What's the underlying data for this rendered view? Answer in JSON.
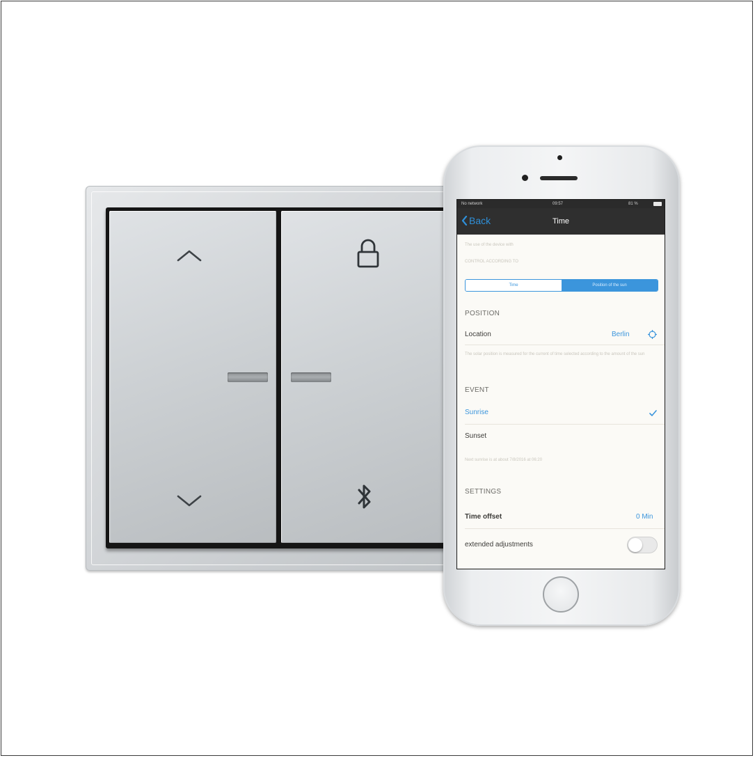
{
  "device_switch": {
    "left_rocker": {
      "top_icon": "chevron-up-icon",
      "bottom_icon": "chevron-down-icon"
    },
    "right_rocker": {
      "top_icon": "lock-icon",
      "bottom_icon": "bluetooth-icon"
    }
  },
  "phone": {
    "status_bar": {
      "carrier": "No network",
      "time": "09:57",
      "battery": "81 %"
    },
    "nav": {
      "back_label": "Back",
      "title": "Time"
    },
    "intro_text": "The use of the device with",
    "control_header": "CONTROL ACCORDING TO",
    "segmented": {
      "option_time": "Time",
      "option_sun": "Position of the sun",
      "selected": "Position of the sun"
    },
    "position_header": "POSITION",
    "location": {
      "label": "Location",
      "value": "Berlin"
    },
    "position_note": "The solar position is measured for the current of time selected according to the amount of the sun",
    "event_header": "EVENT",
    "events": [
      {
        "label": "Sunrise",
        "selected": true
      },
      {
        "label": "Sunset",
        "selected": false
      }
    ],
    "event_note": "Next sunrise is at about 7/8/2016 at 06:20",
    "settings_header": "SETTINGS",
    "time_offset": {
      "label": "Time offset",
      "value": "0 Min"
    },
    "extended": {
      "label": "extended adjustments",
      "enabled": false
    },
    "colors": {
      "accent": "#3b95dc",
      "nav_bg": "#2f2f2f",
      "screen_bg": "#fbfaf6"
    }
  }
}
